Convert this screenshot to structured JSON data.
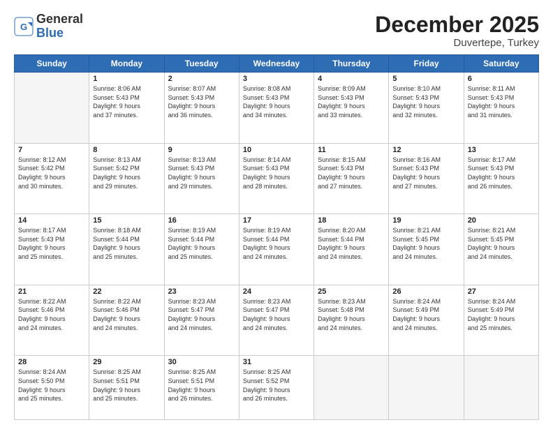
{
  "header": {
    "logo_general": "General",
    "logo_blue": "Blue",
    "month_title": "December 2025",
    "location": "Duvertepe, Turkey"
  },
  "days_of_week": [
    "Sunday",
    "Monday",
    "Tuesday",
    "Wednesday",
    "Thursday",
    "Friday",
    "Saturday"
  ],
  "weeks": [
    [
      {
        "day": "",
        "info": ""
      },
      {
        "day": "1",
        "info": "Sunrise: 8:06 AM\nSunset: 5:43 PM\nDaylight: 9 hours\nand 37 minutes."
      },
      {
        "day": "2",
        "info": "Sunrise: 8:07 AM\nSunset: 5:43 PM\nDaylight: 9 hours\nand 36 minutes."
      },
      {
        "day": "3",
        "info": "Sunrise: 8:08 AM\nSunset: 5:43 PM\nDaylight: 9 hours\nand 34 minutes."
      },
      {
        "day": "4",
        "info": "Sunrise: 8:09 AM\nSunset: 5:43 PM\nDaylight: 9 hours\nand 33 minutes."
      },
      {
        "day": "5",
        "info": "Sunrise: 8:10 AM\nSunset: 5:43 PM\nDaylight: 9 hours\nand 32 minutes."
      },
      {
        "day": "6",
        "info": "Sunrise: 8:11 AM\nSunset: 5:43 PM\nDaylight: 9 hours\nand 31 minutes."
      }
    ],
    [
      {
        "day": "7",
        "info": "Sunrise: 8:12 AM\nSunset: 5:42 PM\nDaylight: 9 hours\nand 30 minutes."
      },
      {
        "day": "8",
        "info": "Sunrise: 8:13 AM\nSunset: 5:42 PM\nDaylight: 9 hours\nand 29 minutes."
      },
      {
        "day": "9",
        "info": "Sunrise: 8:13 AM\nSunset: 5:43 PM\nDaylight: 9 hours\nand 29 minutes."
      },
      {
        "day": "10",
        "info": "Sunrise: 8:14 AM\nSunset: 5:43 PM\nDaylight: 9 hours\nand 28 minutes."
      },
      {
        "day": "11",
        "info": "Sunrise: 8:15 AM\nSunset: 5:43 PM\nDaylight: 9 hours\nand 27 minutes."
      },
      {
        "day": "12",
        "info": "Sunrise: 8:16 AM\nSunset: 5:43 PM\nDaylight: 9 hours\nand 27 minutes."
      },
      {
        "day": "13",
        "info": "Sunrise: 8:17 AM\nSunset: 5:43 PM\nDaylight: 9 hours\nand 26 minutes."
      }
    ],
    [
      {
        "day": "14",
        "info": "Sunrise: 8:17 AM\nSunset: 5:43 PM\nDaylight: 9 hours\nand 25 minutes."
      },
      {
        "day": "15",
        "info": "Sunrise: 8:18 AM\nSunset: 5:44 PM\nDaylight: 9 hours\nand 25 minutes."
      },
      {
        "day": "16",
        "info": "Sunrise: 8:19 AM\nSunset: 5:44 PM\nDaylight: 9 hours\nand 25 minutes."
      },
      {
        "day": "17",
        "info": "Sunrise: 8:19 AM\nSunset: 5:44 PM\nDaylight: 9 hours\nand 24 minutes."
      },
      {
        "day": "18",
        "info": "Sunrise: 8:20 AM\nSunset: 5:44 PM\nDaylight: 9 hours\nand 24 minutes."
      },
      {
        "day": "19",
        "info": "Sunrise: 8:21 AM\nSunset: 5:45 PM\nDaylight: 9 hours\nand 24 minutes."
      },
      {
        "day": "20",
        "info": "Sunrise: 8:21 AM\nSunset: 5:45 PM\nDaylight: 9 hours\nand 24 minutes."
      }
    ],
    [
      {
        "day": "21",
        "info": "Sunrise: 8:22 AM\nSunset: 5:46 PM\nDaylight: 9 hours\nand 24 minutes."
      },
      {
        "day": "22",
        "info": "Sunrise: 8:22 AM\nSunset: 5:46 PM\nDaylight: 9 hours\nand 24 minutes."
      },
      {
        "day": "23",
        "info": "Sunrise: 8:23 AM\nSunset: 5:47 PM\nDaylight: 9 hours\nand 24 minutes."
      },
      {
        "day": "24",
        "info": "Sunrise: 8:23 AM\nSunset: 5:47 PM\nDaylight: 9 hours\nand 24 minutes."
      },
      {
        "day": "25",
        "info": "Sunrise: 8:23 AM\nSunset: 5:48 PM\nDaylight: 9 hours\nand 24 minutes."
      },
      {
        "day": "26",
        "info": "Sunrise: 8:24 AM\nSunset: 5:49 PM\nDaylight: 9 hours\nand 24 minutes."
      },
      {
        "day": "27",
        "info": "Sunrise: 8:24 AM\nSunset: 5:49 PM\nDaylight: 9 hours\nand 25 minutes."
      }
    ],
    [
      {
        "day": "28",
        "info": "Sunrise: 8:24 AM\nSunset: 5:50 PM\nDaylight: 9 hours\nand 25 minutes."
      },
      {
        "day": "29",
        "info": "Sunrise: 8:25 AM\nSunset: 5:51 PM\nDaylight: 9 hours\nand 25 minutes."
      },
      {
        "day": "30",
        "info": "Sunrise: 8:25 AM\nSunset: 5:51 PM\nDaylight: 9 hours\nand 26 minutes."
      },
      {
        "day": "31",
        "info": "Sunrise: 8:25 AM\nSunset: 5:52 PM\nDaylight: 9 hours\nand 26 minutes."
      },
      {
        "day": "",
        "info": ""
      },
      {
        "day": "",
        "info": ""
      },
      {
        "day": "",
        "info": ""
      }
    ]
  ]
}
